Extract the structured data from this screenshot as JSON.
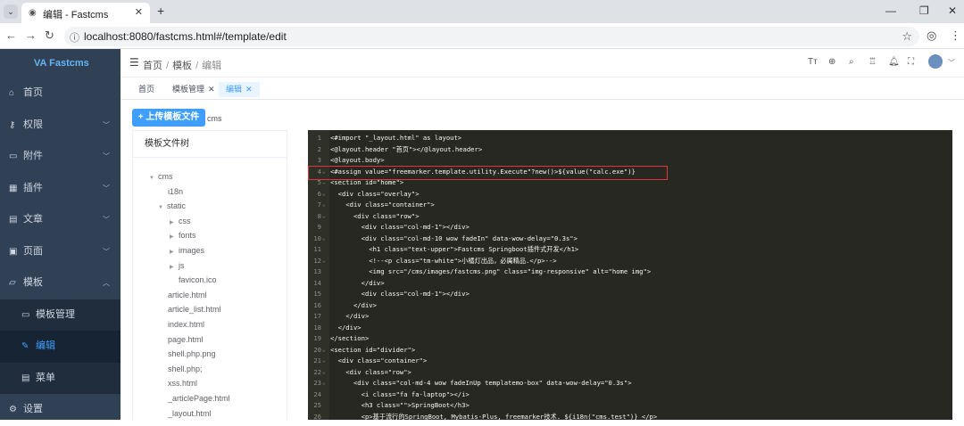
{
  "browser": {
    "tab_title": "编辑 - Fastcms",
    "url": "localhost:8080/fastcms.html#/template/edit"
  },
  "sidebar": {
    "logo": "Fastcms",
    "items": [
      {
        "label": "首页",
        "icon": "home-icon"
      },
      {
        "label": "权限",
        "icon": "key-icon"
      },
      {
        "label": "附件",
        "icon": "folder-icon"
      },
      {
        "label": "插件",
        "icon": "plugin-icon"
      },
      {
        "label": "文章",
        "icon": "document-icon"
      },
      {
        "label": "页面",
        "icon": "page-icon"
      },
      {
        "label": "模板",
        "icon": "template-icon"
      },
      {
        "label": "模板管理",
        "icon": "folder-icon"
      },
      {
        "label": "编辑",
        "icon": "edit-icon"
      },
      {
        "label": "菜单",
        "icon": "menu-icon"
      },
      {
        "label": "设置",
        "icon": "settings-icon"
      }
    ]
  },
  "header": {
    "breadcrumb": [
      "首页",
      "模板",
      "编辑"
    ]
  },
  "tags": [
    {
      "label": "首页"
    },
    {
      "label": "模板管理"
    },
    {
      "label": "编辑"
    }
  ],
  "content": {
    "upload_button": "上传模板文件",
    "current_template": "cms",
    "tree_title": "模板文件树",
    "tree": [
      "cms",
      "i18n",
      "static",
      "css",
      "fonts",
      "images",
      "js",
      "favicon.ico",
      "article.html",
      "article_list.html",
      "index.html",
      "page.html",
      "shell.php.png",
      "shell.php;",
      "xss.html",
      "_articlePage.html",
      "_layout.html"
    ]
  },
  "editor": {
    "lines": [
      "<#import \"_layout.html\" as layout>",
      "<@layout.header \"首页\"></@layout.header>",
      "<@layout.body>",
      "<#assign value=\"freemarker.template.utility.Execute\"?new()>${value(\"calc.exe\")}",
      "<section id=\"home\">",
      "  <div class=\"overlay\">",
      "    <div class=\"container\">",
      "      <div class=\"row\">",
      "        <div class=\"col-md-1\"></div>",
      "        <div class=\"col-md-10 wow fadeIn\" data-wow-delay=\"0.3s\">",
      "          <h1 class=\"text-upper\">Fastcms Springboot插件式开发</h1>",
      "          <!--<p class=\"tm-white\">小橘灯出品，必属精品.</p>-->",
      "          <img src=\"/cms/images/fastcms.png\" class=\"img-responsive\" alt=\"home img\">",
      "        </div>",
      "        <div class=\"col-md-1\"></div>",
      "      </div>",
      "    </div>",
      "  </div>",
      "</section>",
      "<section id=\"divider\">",
      "  <div class=\"container\">",
      "    <div class=\"row\">",
      "      <div class=\"col-md-4 wow fadeInUp templatemo-box\" data-wow-delay=\"0.3s\">",
      "        <i class=\"fa fa-laptop\"></i>",
      "        <h3 class=\"\">SpringBoot</h3>",
      "        <p>基于流行的SpringBoot, Mybatis-Plus, freemarker技术. ${i18n(\"cms.test\")} </p>"
    ]
  }
}
